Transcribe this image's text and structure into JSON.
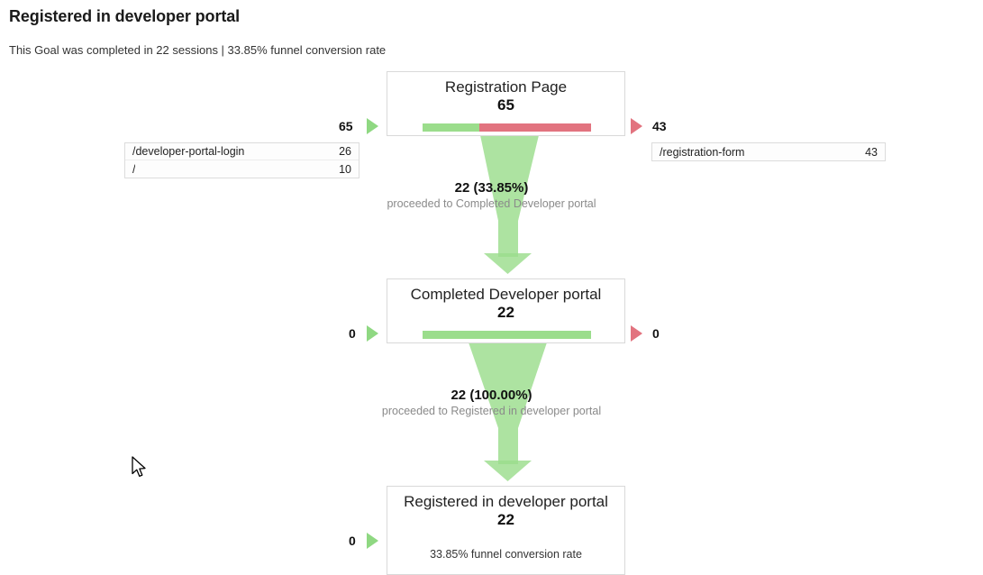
{
  "header": {
    "title": "Registered in developer portal",
    "subtitle": "This Goal was completed in 22 sessions | 33.85% funnel conversion rate"
  },
  "colors": {
    "green": "#9BDD8C",
    "red": "#E2737F",
    "green_triangle": "#8FD882",
    "text": "#222222",
    "muted": "#8a8a8a",
    "box_border": "#d9d9d9"
  },
  "chart_data": {
    "type": "funnel",
    "title": "Registered in developer portal",
    "total_sessions": 22,
    "conversion_rate": "33.85%",
    "steps": [
      {
        "label": "Registration Page",
        "value": "65",
        "value_num": 65,
        "proceeded": 22,
        "dropped": 43,
        "bar_green_pct": 33.85,
        "bar_red_pct": 66.15,
        "entries_label": "65",
        "exits_label": "43",
        "entry_table": [
          {
            "name": "/developer-portal-login",
            "count": "26"
          },
          {
            "name": "/",
            "count": "10"
          }
        ],
        "exit_table": [
          {
            "name": "/registration-form",
            "count": "43"
          }
        ]
      },
      {
        "label": "Completed Developer portal",
        "value": "22",
        "value_num": 22,
        "proceeded": 22,
        "dropped": 0,
        "bar_green_pct": 100,
        "bar_red_pct": 0,
        "entries_label": "0",
        "exits_label": "0",
        "entry_table": [],
        "exit_table": []
      },
      {
        "label": "Registered in developer portal",
        "value": "22",
        "value_num": 22,
        "note": "33.85% funnel conversion rate",
        "entries_label": "0",
        "entry_table": [],
        "exit_table": []
      }
    ],
    "connectors": [
      {
        "main": "22 (33.85%)",
        "sub": "proceeded to Completed Developer portal",
        "count": 22,
        "percent": "33.85%"
      },
      {
        "main": "22 (100.00%)",
        "sub": "proceeded to Registered in developer portal",
        "count": 22,
        "percent": "100.00%"
      }
    ]
  }
}
